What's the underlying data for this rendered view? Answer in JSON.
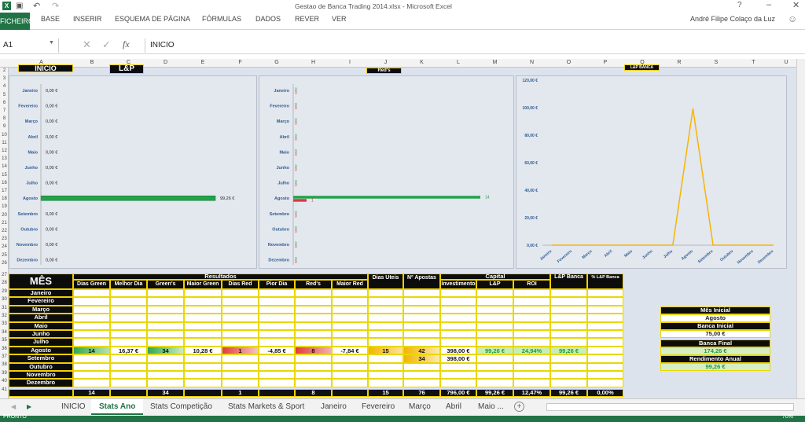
{
  "window": {
    "title": "Gestao de Banca Trading 2014.xlsx - Microsoft Excel",
    "user": "André Filipe Colaço da Luz"
  },
  "ribbon": {
    "file": "FICHEIRO",
    "tabs": [
      "BASE",
      "INSERIR",
      "ESQUEMA DE PÁGINA",
      "FÓRMULAS",
      "DADOS",
      "REVER",
      "VER"
    ]
  },
  "formula": {
    "cell": "A1",
    "fx": "fx",
    "value": "INICIO"
  },
  "columns": [
    "A",
    "B",
    "C",
    "D",
    "E",
    "F",
    "G",
    "H",
    "I",
    "J",
    "K",
    "L",
    "M",
    "N",
    "O",
    "P",
    "Q",
    "R",
    "S",
    "T",
    "U"
  ],
  "rows": [
    "2",
    "3",
    "4",
    "5",
    "6",
    "7",
    "8",
    "9",
    "10",
    "11",
    "12",
    "13",
    "14",
    "15",
    "16",
    "17",
    "18",
    "19",
    "20",
    "21",
    "22",
    "23",
    "24",
    "25",
    "26",
    "27",
    "28",
    "29",
    "30",
    "31",
    "32",
    "33",
    "34",
    "35",
    "36",
    "37",
    "38",
    "39",
    "40",
    "41"
  ],
  "sheet_headers": {
    "inicio": "INICIO",
    "lp": "L&P",
    "reds": "Red's",
    "lp_banca": "L&P BANCA"
  },
  "months": [
    "Janeiro",
    "Fevereiro",
    "Março",
    "Abril",
    "Maio",
    "Junho",
    "Julho",
    "Agosto",
    "Setembro",
    "Outubro",
    "Novembro",
    "Dezembro"
  ],
  "chart_data": [
    {
      "type": "bar",
      "categories": [
        "Janeiro",
        "Fevereiro",
        "Março",
        "Abril",
        "Maio",
        "Junho",
        "Julho",
        "Agosto",
        "Setembro",
        "Outubro",
        "Novembro",
        "Dezembro"
      ],
      "values": [
        0,
        0,
        0,
        0,
        0,
        0,
        0,
        99.26,
        0,
        0,
        0,
        0
      ],
      "labels": [
        "0,00 €",
        "0,00 €",
        "0,00 €",
        "0,00 €",
        "0,00 €",
        "0,00 €",
        "0,00 €",
        "99,26 €",
        "0,00 €",
        "0,00 €",
        "0,00 €",
        "0,00 €"
      ],
      "orientation": "horizontal",
      "color": "#22a24a"
    },
    {
      "type": "bar",
      "categories": [
        "Janeiro",
        "Fevereiro",
        "Março",
        "Abril",
        "Maio",
        "Junho",
        "Julho",
        "Agosto",
        "Setembro",
        "Outubro",
        "Novembro",
        "Dezembro"
      ],
      "series": [
        {
          "name": "Green's",
          "values": [
            0,
            0,
            0,
            0,
            0,
            0,
            0,
            14,
            0,
            0,
            0,
            0
          ],
          "color": "#22a24a"
        },
        {
          "name": "Red's",
          "values": [
            0,
            0,
            0,
            0,
            0,
            0,
            0,
            1,
            0,
            0,
            0,
            0
          ],
          "color": "#d83b3b"
        }
      ],
      "orientation": "horizontal"
    },
    {
      "type": "line",
      "categories": [
        "Janeiro",
        "Fevereiro",
        "Março",
        "Abril",
        "Maio",
        "Junho",
        "Julho",
        "Agosto",
        "Setembro",
        "Outubro",
        "Novembro",
        "Dezembro"
      ],
      "values": [
        0,
        0,
        0,
        0,
        0,
        0,
        0,
        99.26,
        0,
        0,
        0,
        0
      ],
      "yticks": [
        "0,00 €",
        "20,00 €",
        "40,00 €",
        "60,00 €",
        "80,00 €",
        "100,00 €",
        "120,00 €"
      ],
      "ylim": [
        0,
        120
      ],
      "color": "#f7b500"
    }
  ],
  "table": {
    "mes": "MÊS",
    "resultados": "Resultados",
    "capital": "Capital",
    "lp_banca": "L&P Banca",
    "pct_lp_banca": "% L&P Banca",
    "headers": [
      "Dias Green",
      "Melhor Dia",
      "Green's",
      "Maior Green",
      "Dias Red",
      "Pior Dia",
      "Red's",
      "Maior Red",
      "Dias Uteis",
      "Nº Apostas",
      "Investimento",
      "L&P",
      "ROI"
    ],
    "agosto": [
      "14",
      "16,37 €",
      "34",
      "10,28 €",
      "1",
      "-4,85 €",
      "8",
      "-7,84 €",
      "15",
      "42",
      "398,00 €",
      "99,26 €",
      "24,94%",
      "99,26 €"
    ],
    "setembro": [
      "34",
      "398,00 €"
    ],
    "totals": [
      "14",
      "34",
      "1",
      "8",
      "15",
      "76",
      "796,00 €",
      "99,26 €",
      "12,47%",
      "99,26 €",
      "0,00%"
    ]
  },
  "side": {
    "mes_inicial": "Mês Inicial",
    "mes_val": "Agosto",
    "banca_inicial": "Banca Inicial",
    "bi_val": "75,00 €",
    "banca_final": "Banca Final",
    "bf_val": "174,26 €",
    "rend": "Rendimento Anual",
    "rend_val": "99,26 €"
  },
  "sheet_tabs": [
    "INICIO",
    "Stats Ano",
    "Stats Competição",
    "Stats Markets & Sport",
    "Janeiro",
    "Fevereiro",
    "Março",
    "Abril",
    "Maio ..."
  ],
  "status": {
    "ready": "PRONTO",
    "zoom": "70%"
  }
}
